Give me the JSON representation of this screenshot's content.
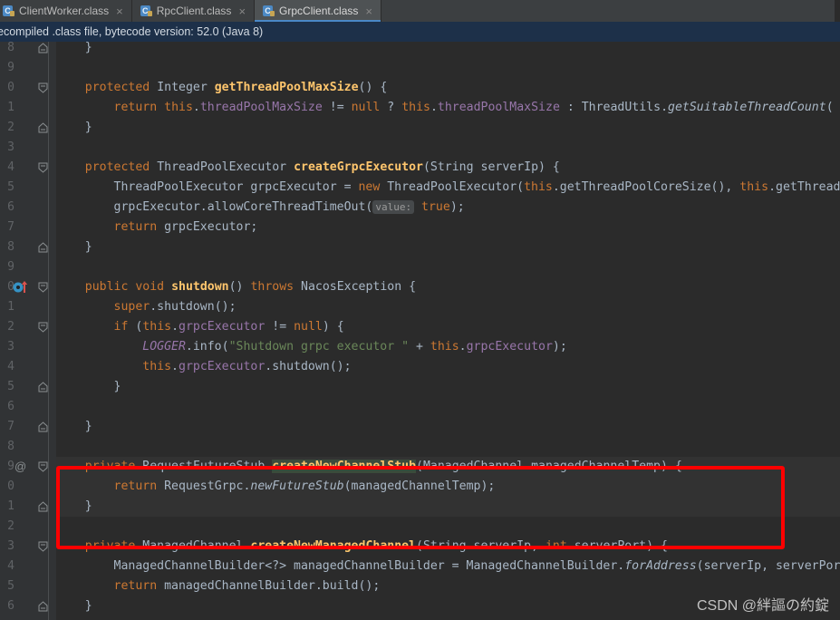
{
  "window": {
    "theme_background": "#2b2b2b",
    "accent": "#4a88c7"
  },
  "tabs": [
    {
      "label": "ClientWorker.class",
      "icon": "class-file-icon",
      "close": "×",
      "active": false
    },
    {
      "label": "RpcClient.class",
      "icon": "class-file-icon",
      "close": "×",
      "active": false
    },
    {
      "label": "GrpcClient.class",
      "icon": "class-file-icon",
      "close": "×",
      "active": true
    }
  ],
  "banner": {
    "text": "ecompiled .class file, bytecode version: 52.0 (Java 8)",
    "background": "#1d3049"
  },
  "gutter": {
    "line_numbers": [
      "8",
      "9",
      "0",
      "1",
      "2",
      "3",
      "4",
      "5",
      "6",
      "7",
      "8",
      "9",
      "0",
      "1",
      "2",
      "3",
      "4",
      "5",
      "6",
      "7",
      "8",
      "9",
      "0",
      "1",
      "2",
      "3",
      "4",
      "5",
      "6"
    ],
    "at_marker": "@",
    "override_icon": "override-method-icon"
  },
  "annotation": {
    "color": "#ff0000",
    "shape": "rectangle",
    "target": "createNewChannelStub method"
  },
  "watermark": {
    "text": "CSDN @絆謳の約錠"
  },
  "code": {
    "lines": [
      {
        "n": "8",
        "fold": "end",
        "tokens": [
          {
            "t": "    }",
            "c": "pln"
          }
        ]
      },
      {
        "n": "9",
        "fold": "",
        "tokens": []
      },
      {
        "n": "0",
        "fold": "start",
        "tokens": [
          {
            "t": "    ",
            "c": "pln"
          },
          {
            "t": "protected",
            "c": "kw"
          },
          {
            "t": " ",
            "c": "pln"
          },
          {
            "t": "Integer",
            "c": "typ"
          },
          {
            "t": " ",
            "c": "pln"
          },
          {
            "t": "getThreadPoolMaxSize",
            "c": "mth"
          },
          {
            "t": "() {",
            "c": "pln"
          }
        ]
      },
      {
        "n": "1",
        "fold": "",
        "tokens": [
          {
            "t": "        ",
            "c": "pln"
          },
          {
            "t": "return",
            "c": "kw"
          },
          {
            "t": " ",
            "c": "pln"
          },
          {
            "t": "this",
            "c": "kw"
          },
          {
            "t": ".",
            "c": "pln"
          },
          {
            "t": "threadPoolMaxSize",
            "c": "fld"
          },
          {
            "t": " != ",
            "c": "pln"
          },
          {
            "t": "null",
            "c": "kw"
          },
          {
            "t": " ? ",
            "c": "pln"
          },
          {
            "t": "this",
            "c": "kw"
          },
          {
            "t": ".",
            "c": "pln"
          },
          {
            "t": "threadPoolMaxSize",
            "c": "fld"
          },
          {
            "t": " : ",
            "c": "pln"
          },
          {
            "t": "ThreadUtils",
            "c": "typ"
          },
          {
            "t": ".",
            "c": "pln"
          },
          {
            "t": "getSuitableThreadCount",
            "c": "sta"
          },
          {
            "t": "( t",
            "c": "pln"
          }
        ]
      },
      {
        "n": "2",
        "fold": "end",
        "tokens": [
          {
            "t": "    }",
            "c": "pln"
          }
        ]
      },
      {
        "n": "3",
        "fold": "",
        "tokens": []
      },
      {
        "n": "4",
        "fold": "start",
        "tokens": [
          {
            "t": "    ",
            "c": "pln"
          },
          {
            "t": "protected",
            "c": "kw"
          },
          {
            "t": " ",
            "c": "pln"
          },
          {
            "t": "ThreadPoolExecutor",
            "c": "typ"
          },
          {
            "t": " ",
            "c": "pln"
          },
          {
            "t": "createGrpcExecutor",
            "c": "mth"
          },
          {
            "t": "(String serverIp) {",
            "c": "pln"
          }
        ]
      },
      {
        "n": "5",
        "fold": "",
        "tokens": [
          {
            "t": "        ThreadPoolExecutor grpcExecutor = ",
            "c": "pln"
          },
          {
            "t": "new",
            "c": "kw"
          },
          {
            "t": " ThreadPoolExecutor(",
            "c": "pln"
          },
          {
            "t": "this",
            "c": "kw"
          },
          {
            "t": ".getThreadPoolCoreSize(), ",
            "c": "pln"
          },
          {
            "t": "this",
            "c": "kw"
          },
          {
            "t": ".getThreadP",
            "c": "pln"
          }
        ]
      },
      {
        "n": "6",
        "fold": "",
        "tokens": [
          {
            "t": "        grpcExecutor.allowCoreThreadTimeOut(",
            "c": "pln"
          },
          {
            "t": "value:",
            "c": "inlay"
          },
          {
            "t": " ",
            "c": "pln"
          },
          {
            "t": "true",
            "c": "kw"
          },
          {
            "t": ");",
            "c": "pln"
          }
        ]
      },
      {
        "n": "7",
        "fold": "",
        "tokens": [
          {
            "t": "        ",
            "c": "pln"
          },
          {
            "t": "return",
            "c": "kw"
          },
          {
            "t": " grpcExecutor;",
            "c": "pln"
          }
        ]
      },
      {
        "n": "8",
        "fold": "end",
        "tokens": [
          {
            "t": "    }",
            "c": "pln"
          }
        ]
      },
      {
        "n": "9",
        "fold": "",
        "tokens": []
      },
      {
        "n": "0",
        "fold": "start",
        "gutter_icon": "override-method-icon",
        "tokens": [
          {
            "t": "    ",
            "c": "pln"
          },
          {
            "t": "public",
            "c": "kw"
          },
          {
            "t": " ",
            "c": "pln"
          },
          {
            "t": "void",
            "c": "kw"
          },
          {
            "t": " ",
            "c": "pln"
          },
          {
            "t": "shutdown",
            "c": "mth"
          },
          {
            "t": "() ",
            "c": "pln"
          },
          {
            "t": "throws",
            "c": "kw"
          },
          {
            "t": " NacosException {",
            "c": "pln"
          }
        ]
      },
      {
        "n": "1",
        "fold": "",
        "tokens": [
          {
            "t": "        ",
            "c": "pln"
          },
          {
            "t": "super",
            "c": "kw"
          },
          {
            "t": ".shutdown();",
            "c": "pln"
          }
        ]
      },
      {
        "n": "2",
        "fold": "start",
        "tokens": [
          {
            "t": "        ",
            "c": "pln"
          },
          {
            "t": "if",
            "c": "kw"
          },
          {
            "t": " (",
            "c": "pln"
          },
          {
            "t": "this",
            "c": "kw"
          },
          {
            "t": ".",
            "c": "pln"
          },
          {
            "t": "grpcExecutor",
            "c": "fld"
          },
          {
            "t": " != ",
            "c": "pln"
          },
          {
            "t": "null",
            "c": "kw"
          },
          {
            "t": ") {",
            "c": "pln"
          }
        ]
      },
      {
        "n": "3",
        "fold": "",
        "tokens": [
          {
            "t": "            ",
            "c": "pln"
          },
          {
            "t": "LOGGER",
            "c": "fldi"
          },
          {
            "t": ".info(",
            "c": "pln"
          },
          {
            "t": "\"Shutdown grpc executor \"",
            "c": "str"
          },
          {
            "t": " + ",
            "c": "pln"
          },
          {
            "t": "this",
            "c": "kw"
          },
          {
            "t": ".",
            "c": "pln"
          },
          {
            "t": "grpcExecutor",
            "c": "fld"
          },
          {
            "t": ");",
            "c": "pln"
          }
        ]
      },
      {
        "n": "4",
        "fold": "",
        "tokens": [
          {
            "t": "            ",
            "c": "pln"
          },
          {
            "t": "this",
            "c": "kw"
          },
          {
            "t": ".",
            "c": "pln"
          },
          {
            "t": "grpcExecutor",
            "c": "fld"
          },
          {
            "t": ".shutdown();",
            "c": "pln"
          }
        ]
      },
      {
        "n": "5",
        "fold": "end",
        "tokens": [
          {
            "t": "        }",
            "c": "pln"
          }
        ]
      },
      {
        "n": "6",
        "fold": "",
        "tokens": []
      },
      {
        "n": "7",
        "fold": "end",
        "tokens": [
          {
            "t": "    }",
            "c": "pln"
          }
        ]
      },
      {
        "n": "8",
        "fold": "",
        "tokens": []
      },
      {
        "n": "9",
        "fold": "start",
        "gutter_at": "@",
        "tokens": [
          {
            "t": "    ",
            "c": "pln"
          },
          {
            "t": "private",
            "c": "kw"
          },
          {
            "t": " ",
            "c": "pln"
          },
          {
            "t": "RequestFutureStub",
            "c": "typ"
          },
          {
            "t": " ",
            "c": "pln"
          },
          {
            "t": "createNewChannelStub",
            "c": "mth hl"
          },
          {
            "t": "(ManagedChannel managedChannelTemp) {",
            "c": "pln"
          }
        ]
      },
      {
        "n": "0",
        "fold": "",
        "tokens": [
          {
            "t": "        ",
            "c": "pln"
          },
          {
            "t": "return",
            "c": "kw"
          },
          {
            "t": " RequestGrpc.",
            "c": "pln"
          },
          {
            "t": "newFutureStub",
            "c": "mthi"
          },
          {
            "t": "(managedChannelTemp);",
            "c": "pln"
          }
        ]
      },
      {
        "n": "1",
        "fold": "end",
        "tokens": [
          {
            "t": "    }",
            "c": "pln"
          }
        ]
      },
      {
        "n": "2",
        "fold": "",
        "tokens": []
      },
      {
        "n": "3",
        "fold": "start",
        "tokens": [
          {
            "t": "    ",
            "c": "pln"
          },
          {
            "t": "private",
            "c": "kw"
          },
          {
            "t": " ",
            "c": "pln"
          },
          {
            "t": "ManagedChannel",
            "c": "typ"
          },
          {
            "t": " ",
            "c": "pln"
          },
          {
            "t": "createNewManagedChannel",
            "c": "mth"
          },
          {
            "t": "(String serverIp, ",
            "c": "pln"
          },
          {
            "t": "int",
            "c": "kw"
          },
          {
            "t": " serverPort) {",
            "c": "pln"
          }
        ]
      },
      {
        "n": "4",
        "fold": "",
        "tokens": [
          {
            "t": "        ManagedChannelBuilder<?> managedChannelBuilder = ManagedChannelBuilder.",
            "c": "pln"
          },
          {
            "t": "forAddress",
            "c": "sta"
          },
          {
            "t": "(serverIp, serverPort",
            "c": "pln"
          }
        ]
      },
      {
        "n": "5",
        "fold": "",
        "tokens": [
          {
            "t": "        ",
            "c": "pln"
          },
          {
            "t": "return",
            "c": "kw"
          },
          {
            "t": " managedChannelBuilder.build();",
            "c": "pln"
          }
        ]
      },
      {
        "n": "6",
        "fold": "end",
        "tokens": [
          {
            "t": "    }",
            "c": "pln"
          }
        ]
      }
    ]
  }
}
